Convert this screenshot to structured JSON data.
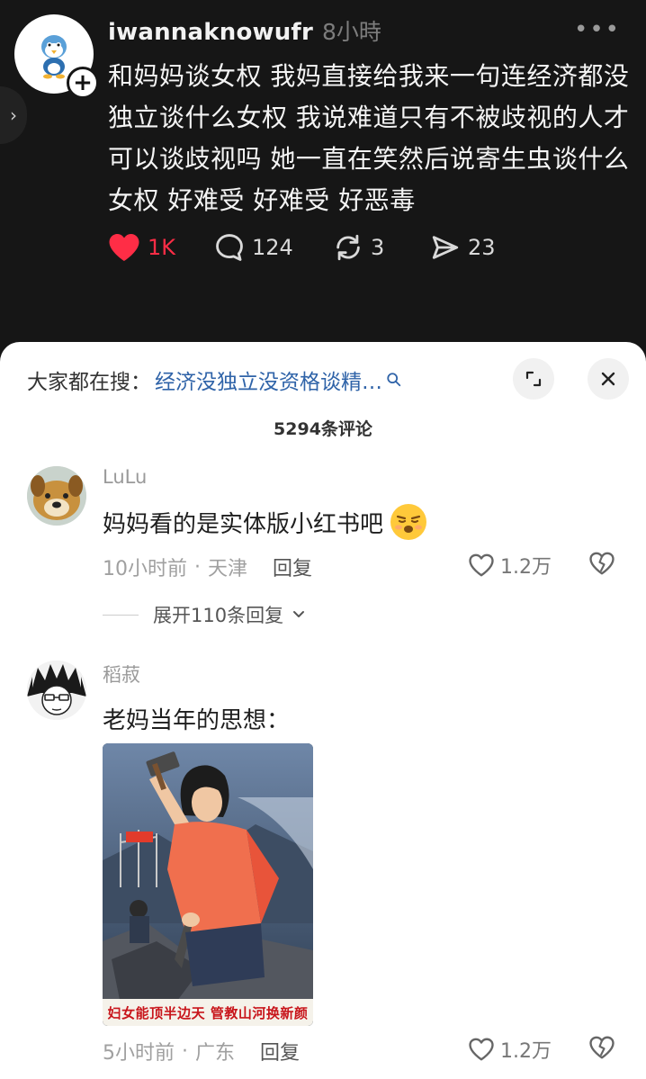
{
  "post": {
    "username": "iwannaknowufr",
    "time": "8小時",
    "text": "和妈妈谈女权 我妈直接给我来一句连经济都没独立谈什么女权 我说难道只有不被歧视的人才可以谈歧视吗 她一直在笑然后说寄生虫谈什么女权 好难受 好难受 好恶毒",
    "likes": "1K",
    "comments": "124",
    "reposts": "3",
    "shares": "23"
  },
  "sheet": {
    "search_prefix": "大家都在搜：",
    "search_query": "经济没独立没资格谈精…",
    "comment_total": "5294条评论"
  },
  "comments": [
    {
      "name": "LuLu",
      "text": "妈妈看的是实体版小红书吧",
      "time": "10小时前",
      "location": "天津",
      "reply_label": "回复",
      "likes": "1.2万",
      "expand_label": "展开110条回复"
    },
    {
      "name": "稻菽",
      "text": "老妈当年的思想：",
      "poster_caption": "妇女能顶半边天 管教山河换新颜",
      "time": "5小时前",
      "location": "广东",
      "reply_label": "回复",
      "likes": "1.2万"
    }
  ],
  "colors": {
    "like_red": "#ff2d46",
    "link_blue": "#2f63a8",
    "dark_bg": "#161616"
  },
  "icons": [
    "heart-icon",
    "comment-bubble-icon",
    "repost-icon",
    "share-icon",
    "more-icon",
    "search-icon",
    "expand-icon",
    "close-icon",
    "dislike-icon",
    "chevron-down-icon"
  ]
}
